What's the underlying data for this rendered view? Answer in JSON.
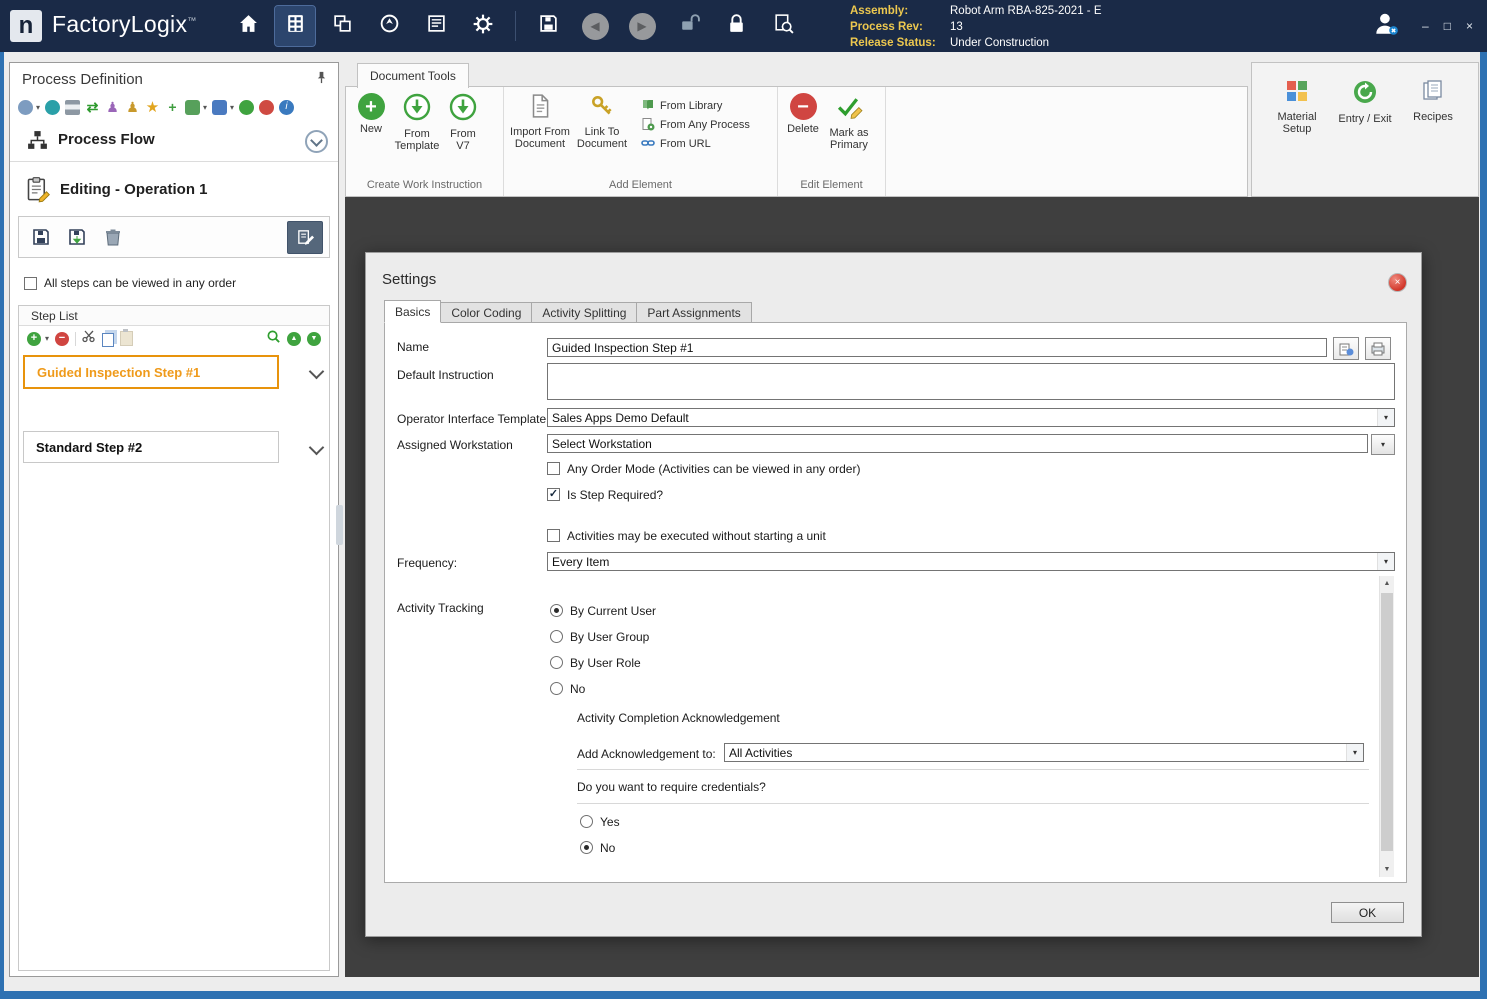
{
  "icons": {
    "logo": "n",
    "plus": "+",
    "minus": "−",
    "check": "✓",
    "caret": "▾",
    "tri_up": "▲",
    "tri_down": "▼",
    "arrow_left": "◀",
    "arrow_right": "▶",
    "sync": "⇄",
    "user": "♟",
    "star": "★",
    "info": "i"
  },
  "titlebar": {
    "app_name": "FactoryLogix",
    "trademark": "™",
    "info": {
      "assembly_label": "Assembly:",
      "assembly_value": "Robot Arm RBA-825-2021 - E",
      "process_rev_label": "Process Rev:",
      "process_rev_value": "13",
      "release_status_label": "Release Status:",
      "release_status_value": "Under Construction"
    },
    "window": {
      "minimize": "–",
      "maximize": "□",
      "close": "×"
    }
  },
  "left_panel": {
    "title": "Process Definition",
    "process_flow": {
      "label": "Process Flow"
    },
    "editing": {
      "label": "Editing - Operation 1"
    },
    "any_order_checkbox": "All steps can be viewed in any order",
    "step_list": {
      "title": "Step List",
      "steps": [
        {
          "label": "Guided Inspection Step #1"
        },
        {
          "label": "Standard Step #2"
        }
      ]
    }
  },
  "ribbon": {
    "tab": "Document Tools",
    "create_group": {
      "label": "Create Work Instruction",
      "new": "New",
      "from_template": "From Template",
      "from_v7": "From V7"
    },
    "add_group": {
      "label": "Add Element",
      "import_from_document": "Import From Document",
      "link_to_document": "Link To Document",
      "from_library": "From Library",
      "from_any_process": "From Any Process",
      "from_url": "From URL"
    },
    "edit_group": {
      "label": "Edit Element",
      "delete": "Delete",
      "mark_as_primary": "Mark as Primary"
    },
    "right_group": {
      "material_setup": "Material Setup",
      "entry_exit": "Entry / Exit",
      "recipes": "Recipes"
    }
  },
  "dialog": {
    "title": "Settings",
    "tabs": [
      "Basics",
      "Color Coding",
      "Activity Splitting",
      "Part Assignments"
    ],
    "name_label": "Name",
    "name_value": "Guided Inspection Step #1",
    "default_instruction_label": "Default Instruction",
    "default_instruction_value": "",
    "template_label": "Operator Interface Template",
    "template_value": "Sales Apps Demo Default",
    "workstation_label": "Assigned Workstation",
    "workstation_value": "Select Workstation",
    "any_order_mode_label": "Any Order Mode (Activities can be viewed in any order)",
    "step_required_label": "Is Step Required?",
    "without_unit_label": "Activities may be executed without starting a unit",
    "frequency_label": "Frequency:",
    "frequency_value": "Every Item",
    "activity_tracking_label": "Activity Tracking",
    "tracking_options": [
      "By Current User",
      "By User Group",
      "By User Role",
      "No"
    ],
    "ack_section_title": "Activity Completion Acknowledgement",
    "ack_label": "Add Acknowledgement to:",
    "ack_value": "All Activities",
    "credentials_question": "Do you want to require credentials?",
    "credentials_yes": "Yes",
    "credentials_no": "No",
    "ok_label": "OK"
  }
}
